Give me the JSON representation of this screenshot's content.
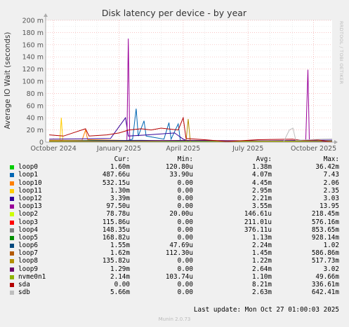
{
  "chart_data": {
    "type": "line",
    "title": "Disk latency per device - by year",
    "ylabel": "Average IO Wait (seconds)",
    "y_ticks": [
      "0",
      "20 m",
      "40 m",
      "60 m",
      "80 m",
      "100 m",
      "120 m",
      "140 m",
      "160 m",
      "180 m",
      "200 m"
    ],
    "ylim": [
      0,
      0.2
    ],
    "x_ticks": [
      "October 2024",
      "January 2025",
      "April 2025",
      "July 2025",
      "October 2025"
    ],
    "xlim": [
      "2024-09-20",
      "2025-10-27"
    ],
    "grid": true,
    "series": [
      {
        "name": "loop0",
        "color": "#00cc00",
        "points": [
          [
            "2024-09-25",
            0.002
          ],
          [
            "2024-12-10",
            0.003
          ],
          [
            "2025-01-20",
            0.002
          ],
          [
            "2025-02-25",
            0.002
          ],
          [
            "2025-04-01",
            0.001
          ],
          [
            "2025-10-27",
            0.0016
          ]
        ]
      },
      {
        "name": "loop1",
        "color": "#0066b3",
        "points": [
          [
            "2025-01-10",
            0.002
          ],
          [
            "2025-01-20",
            0.005
          ],
          [
            "2025-01-25",
            0.055
          ],
          [
            "2025-01-28",
            0.01
          ],
          [
            "2025-02-05",
            0.035
          ],
          [
            "2025-02-08",
            0.01
          ],
          [
            "2025-03-05",
            0.005
          ],
          [
            "2025-03-12",
            0.032
          ],
          [
            "2025-03-15",
            0.005
          ],
          [
            "2025-03-25",
            0.03
          ],
          [
            "2025-03-28",
            0.003
          ],
          [
            "2025-04-05",
            0.001
          ],
          [
            "2025-10-27",
            0.0005
          ]
        ]
      },
      {
        "name": "loop10",
        "color": "#ff8000",
        "points": [
          [
            "2024-09-25",
            0.003
          ],
          [
            "2024-11-10",
            0.003
          ],
          [
            "2024-11-15",
            0.02
          ],
          [
            "2024-11-18",
            0.004
          ],
          [
            "2025-01-01",
            0.003
          ],
          [
            "2025-04-01",
            0.001
          ],
          [
            "2025-10-27",
            0.0005
          ]
        ]
      },
      {
        "name": "loop11",
        "color": "#ffcc00",
        "points": [
          [
            "2024-09-25",
            0.003
          ],
          [
            "2024-10-10",
            0.003
          ],
          [
            "2024-10-12",
            0.04
          ],
          [
            "2024-10-14",
            0.003
          ],
          [
            "2025-04-01",
            0.001
          ],
          [
            "2025-10-27",
            0.0013
          ]
        ]
      },
      {
        "name": "loop12",
        "color": "#330099",
        "points": [
          [
            "2024-09-25",
            0.005
          ],
          [
            "2024-12-20",
            0.006
          ],
          [
            "2025-01-10",
            0.04
          ],
          [
            "2025-01-14",
            0.01
          ],
          [
            "2025-02-10",
            0.012
          ],
          [
            "2025-03-20",
            0.015
          ],
          [
            "2025-04-01",
            0.005
          ],
          [
            "2025-04-10",
            0.001
          ],
          [
            "2025-10-27",
            0.0034
          ]
        ]
      },
      {
        "name": "loop13",
        "color": "#990099",
        "points": [
          [
            "2024-09-25",
            0.002
          ],
          [
            "2025-01-12",
            0.002
          ],
          [
            "2025-01-14",
            0.17
          ],
          [
            "2025-01-16",
            0.002
          ],
          [
            "2025-09-20",
            0.002
          ],
          [
            "2025-09-23",
            0.119
          ],
          [
            "2025-09-25",
            0.003
          ],
          [
            "2025-10-27",
            0.0001
          ]
        ]
      },
      {
        "name": "loop2",
        "color": "#ccff00",
        "points": [
          [
            "2024-09-25",
            0.001
          ],
          [
            "2025-04-01",
            0.0002
          ],
          [
            "2025-10-27",
            0.0001
          ]
        ]
      },
      {
        "name": "loop3",
        "color": "#ff0000",
        "points": [
          [
            "2024-09-25",
            0.001
          ],
          [
            "2025-04-01",
            0.0005
          ],
          [
            "2025-10-27",
            0.0001
          ]
        ]
      },
      {
        "name": "loop4",
        "color": "#808080",
        "points": [
          [
            "2024-09-25",
            0.001
          ],
          [
            "2025-04-01",
            0.0004
          ],
          [
            "2025-10-27",
            0.0001
          ]
        ]
      },
      {
        "name": "loop5",
        "color": "#008f00",
        "points": [
          [
            "2024-09-25",
            0.001
          ],
          [
            "2025-04-01",
            0.001
          ],
          [
            "2025-10-27",
            0.0002
          ]
        ]
      },
      {
        "name": "loop6",
        "color": "#00487d",
        "points": [
          [
            "2024-09-25",
            0.002
          ],
          [
            "2025-02-01",
            0.003
          ],
          [
            "2025-04-01",
            0.002
          ],
          [
            "2025-10-27",
            0.0016
          ]
        ]
      },
      {
        "name": "loop7",
        "color": "#b35a00",
        "points": [
          [
            "2024-09-25",
            0.002
          ],
          [
            "2025-04-01",
            0.001
          ],
          [
            "2025-10-27",
            0.0016
          ]
        ]
      },
      {
        "name": "loop8",
        "color": "#b38f00",
        "points": [
          [
            "2025-03-25",
            0.001
          ],
          [
            "2025-04-05",
            0.001
          ],
          [
            "2025-04-08",
            0.038
          ],
          [
            "2025-04-11",
            0.001
          ],
          [
            "2025-10-27",
            0.0001
          ]
        ]
      },
      {
        "name": "loop9",
        "color": "#6b006b",
        "points": [
          [
            "2024-09-25",
            0.001
          ],
          [
            "2025-04-01",
            0.003
          ],
          [
            "2025-10-27",
            0.0013
          ]
        ]
      },
      {
        "name": "nvme0n1",
        "color": "#8fb300",
        "points": [
          [
            "2024-09-25",
            0.001
          ],
          [
            "2025-04-01",
            0.001
          ],
          [
            "2025-10-27",
            0.0021
          ]
        ]
      },
      {
        "name": "sda",
        "color": "#b30000",
        "points": [
          [
            "2024-09-25",
            0.012
          ],
          [
            "2024-10-15",
            0.01
          ],
          [
            "2024-11-15",
            0.022
          ],
          [
            "2024-11-20",
            0.01
          ],
          [
            "2024-12-15",
            0.012
          ],
          [
            "2025-01-01",
            0.015
          ],
          [
            "2025-01-15",
            0.02
          ],
          [
            "2025-02-01",
            0.022
          ],
          [
            "2025-02-15",
            0.02
          ],
          [
            "2025-03-01",
            0.023
          ],
          [
            "2025-03-25",
            0.02
          ],
          [
            "2025-04-01",
            0.04
          ],
          [
            "2025-04-05",
            0.006
          ],
          [
            "2025-05-01",
            0.004
          ],
          [
            "2025-06-01",
            0.001
          ],
          [
            "2025-07-15",
            0.004
          ],
          [
            "2025-09-01",
            0.005
          ],
          [
            "2025-09-15",
            0.003
          ],
          [
            "2025-10-05",
            0.004
          ],
          [
            "2025-10-27",
            0.0
          ]
        ]
      },
      {
        "name": "sdb",
        "color": "#bebebe",
        "points": [
          [
            "2025-08-20",
            0.001
          ],
          [
            "2025-08-28",
            0.02
          ],
          [
            "2025-09-02",
            0.023
          ],
          [
            "2025-09-06",
            0.003
          ],
          [
            "2025-10-27",
            0.0057
          ]
        ]
      }
    ]
  },
  "legend": {
    "headers": {
      "cur": "Cur:",
      "min": "Min:",
      "avg": "Avg:",
      "max": "Max:"
    },
    "rows": [
      {
        "name": "loop0",
        "color": "#00cc00",
        "cur": "1.60m",
        "min": "120.80u",
        "avg": "1.38m",
        "max": "36.42m"
      },
      {
        "name": "loop1",
        "color": "#0066b3",
        "cur": "487.66u",
        "min": "33.90u",
        "avg": "4.07m",
        "max": "7.43"
      },
      {
        "name": "loop10",
        "color": "#ff8000",
        "cur": "532.15u",
        "min": "0.00",
        "avg": "4.45m",
        "max": "2.06"
      },
      {
        "name": "loop11",
        "color": "#ffcc00",
        "cur": "1.30m",
        "min": "0.00",
        "avg": "2.95m",
        "max": "2.35"
      },
      {
        "name": "loop12",
        "color": "#330099",
        "cur": "3.39m",
        "min": "0.00",
        "avg": "2.21m",
        "max": "3.03"
      },
      {
        "name": "loop13",
        "color": "#990099",
        "cur": "97.50u",
        "min": "0.00",
        "avg": "3.55m",
        "max": "13.95"
      },
      {
        "name": "loop2",
        "color": "#ccff00",
        "cur": "78.78u",
        "min": "20.00u",
        "avg": "146.61u",
        "max": "218.45m"
      },
      {
        "name": "loop3",
        "color": "#ff0000",
        "cur": "115.86u",
        "min": "0.00",
        "avg": "211.01u",
        "max": "576.16m"
      },
      {
        "name": "loop4",
        "color": "#808080",
        "cur": "148.35u",
        "min": "0.00",
        "avg": "376.11u",
        "max": "853.65m"
      },
      {
        "name": "loop5",
        "color": "#008f00",
        "cur": "168.82u",
        "min": "0.00",
        "avg": "1.13m",
        "max": "928.14m"
      },
      {
        "name": "loop6",
        "color": "#00487d",
        "cur": "1.55m",
        "min": "47.69u",
        "avg": "2.24m",
        "max": "1.02"
      },
      {
        "name": "loop7",
        "color": "#b35a00",
        "cur": "1.62m",
        "min": "112.30u",
        "avg": "1.45m",
        "max": "586.86m"
      },
      {
        "name": "loop8",
        "color": "#b38f00",
        "cur": "135.82u",
        "min": "0.00",
        "avg": "1.22m",
        "max": "517.73m"
      },
      {
        "name": "loop9",
        "color": "#6b006b",
        "cur": "1.29m",
        "min": "0.00",
        "avg": "2.64m",
        "max": "3.02"
      },
      {
        "name": "nvme0n1",
        "color": "#8fb300",
        "cur": "2.14m",
        "min": "103.74u",
        "avg": "1.10m",
        "max": "49.66m"
      },
      {
        "name": "sda",
        "color": "#b30000",
        "cur": "0.00",
        "min": "0.00",
        "avg": "8.21m",
        "max": "336.61m"
      },
      {
        "name": "sdb",
        "color": "#bebebe",
        "cur": "5.66m",
        "min": "0.00",
        "avg": "2.63m",
        "max": "642.41m"
      }
    ]
  },
  "last_update": "Last update: Mon Oct 27 01:00:03 2025",
  "footer": "Munin 2.0.73",
  "side_label": "RRDTOOL / TOBI OETIKER"
}
